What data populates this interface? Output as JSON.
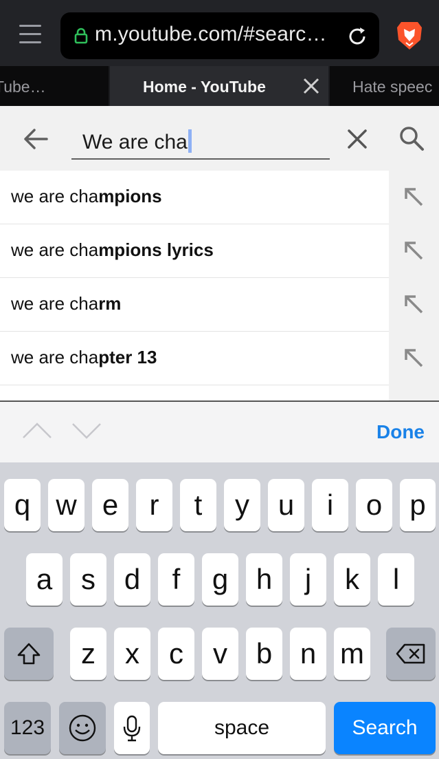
{
  "browser": {
    "url": "m.youtube.com/#searc…",
    "tabs": {
      "left": "Tube…",
      "active": "Home - YouTube",
      "right": "Hate speec"
    }
  },
  "search": {
    "query": "We are cha",
    "suggestions": [
      {
        "prefix": "we are cha",
        "completion": "mpions"
      },
      {
        "prefix": "we are cha",
        "completion": "mpions lyrics"
      },
      {
        "prefix": "we are cha",
        "completion": "rm"
      },
      {
        "prefix": "we are cha",
        "completion": "pter 13"
      }
    ]
  },
  "accessory": {
    "done_label": "Done"
  },
  "keyboard": {
    "row1": [
      "q",
      "w",
      "e",
      "r",
      "t",
      "y",
      "u",
      "i",
      "o",
      "p"
    ],
    "row2": [
      "a",
      "s",
      "d",
      "f",
      "g",
      "h",
      "j",
      "k",
      "l"
    ],
    "row3": [
      "z",
      "x",
      "c",
      "v",
      "b",
      "n",
      "m"
    ],
    "numbers_label": "123",
    "space_label": "space",
    "search_label": "Search"
  },
  "colors": {
    "accent": "#0a84ff",
    "done": "#1a82e8",
    "lock": "#2fbf5b",
    "brave": "#fb542b"
  },
  "icons": [
    "menu-icon",
    "lock-icon",
    "reload-icon",
    "brave-lion-icon",
    "close-icon",
    "back-arrow-icon",
    "clear-icon",
    "search-icon",
    "fill-arrow-icon",
    "chevron-up-icon",
    "chevron-down-icon",
    "shift-icon",
    "backspace-icon",
    "emoji-icon",
    "microphone-icon"
  ]
}
